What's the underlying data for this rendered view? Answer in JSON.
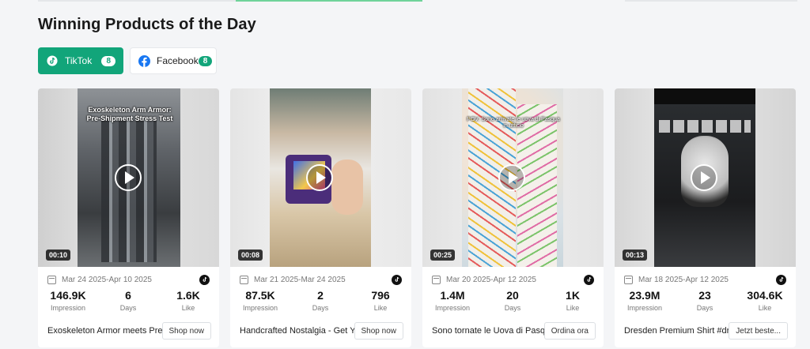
{
  "section": {
    "title": "Winning Products of the Day"
  },
  "tabs": [
    {
      "label": "TikTok",
      "count": "8",
      "icon": "tiktok-icon",
      "active": true
    },
    {
      "label": "Facebook",
      "count": "8",
      "icon": "facebook-icon",
      "active": false
    }
  ],
  "colors": {
    "accent": "#12a57a",
    "facebook": "#1877f2"
  },
  "cards": [
    {
      "overlay": "Exoskeleton Arm Armor: Pre-Shipment Stress Test",
      "duration": "00:10",
      "date_range": "Mar 24 2025-Apr 10 2025",
      "impression": "146.9K",
      "days": "6",
      "like": "1.6K",
      "title": "Exoskeleton Armor meets Pre...",
      "button": "Shop now"
    },
    {
      "overlay": "",
      "duration": "00:08",
      "date_range": "Mar 21 2025-Mar 24 2025",
      "impression": "87.5K",
      "days": "2",
      "like": "796",
      "title": "Handcrafted Nostalgia - Get Y...",
      "button": "Shop now"
    },
    {
      "overlay": "POV: Sono arrivate le uova di Pasqua in ufficio",
      "duration": "00:25",
      "date_range": "Mar 20 2025-Apr 12 2025",
      "impression": "1.4M",
      "days": "20",
      "like": "1K",
      "title": "Sono tornate le Uova di Pasqu...",
      "button": "Ordina ora"
    },
    {
      "overlay": "",
      "duration": "00:13",
      "date_range": "Mar 18 2025-Apr 12 2025",
      "impression": "23.9M",
      "days": "23",
      "like": "304.6K",
      "title": "Dresden Premium Shirt #dr...",
      "button": "Jetzt beste..."
    }
  ],
  "labels": {
    "impression": "Impression",
    "days": "Days",
    "like": "Like"
  }
}
